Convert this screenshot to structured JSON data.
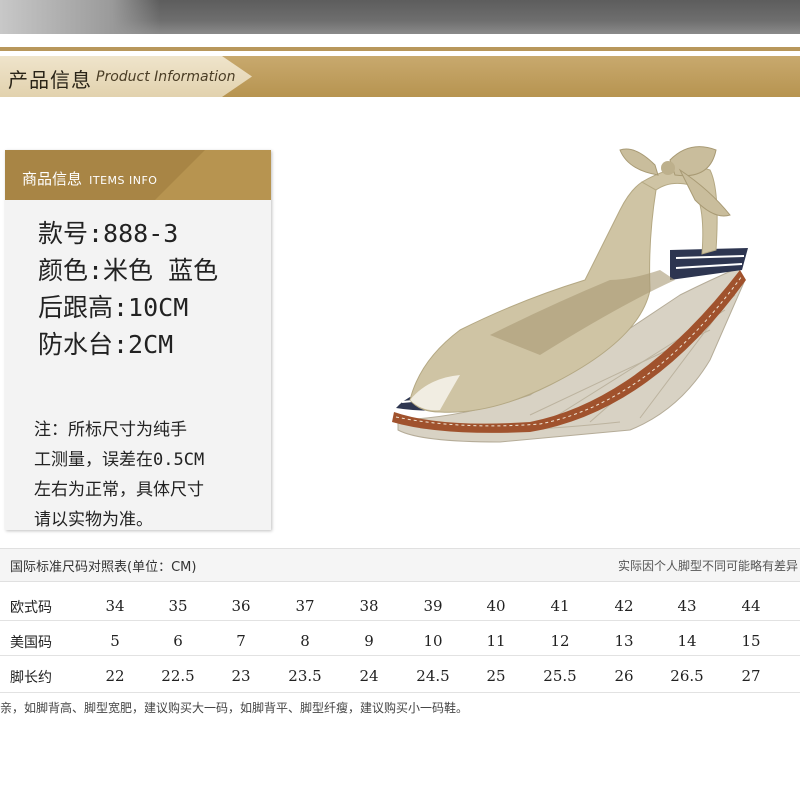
{
  "header": {
    "title_cn": "产品信息",
    "title_en": "Product Information"
  },
  "items_info": {
    "title_cn": "商品信息",
    "title_en": "ITEMS INFO",
    "specs": [
      "款号:888-3",
      "颜色:米色 蓝色",
      "后跟高:10CM",
      "防水台:2CM"
    ],
    "note_lines": [
      "注：所标尺寸为纯手",
      "工测量，误差在0.5CM",
      "左右为正常，具体尺寸",
      "请以实物为准。"
    ]
  },
  "size_table": {
    "title": "国际标准尺码对照表(单位：CM)",
    "note": "实际因个人脚型不同可能略有差异",
    "rows": [
      {
        "label": "欧式码",
        "values": [
          "34",
          "35",
          "36",
          "37",
          "38",
          "39",
          "40",
          "41",
          "42",
          "43",
          "44"
        ]
      },
      {
        "label": "美国码",
        "values": [
          "5",
          "6",
          "7",
          "8",
          "9",
          "10",
          "11",
          "12",
          "13",
          "14",
          "15"
        ]
      },
      {
        "label": "脚长约",
        "values": [
          "22",
          "22.5",
          "23",
          "23.5",
          "24",
          "24.5",
          "25",
          "25.5",
          "26",
          "26.5",
          "27"
        ]
      }
    ],
    "footer": "亲，如脚背高、脚型宽肥，建议购买大一码，如脚背平、脚型纤瘦，建议购买小一码鞋。"
  },
  "colors": {
    "gold": "#b79450",
    "cream": "#e2d2ae",
    "panel": "#f3f3f3"
  }
}
